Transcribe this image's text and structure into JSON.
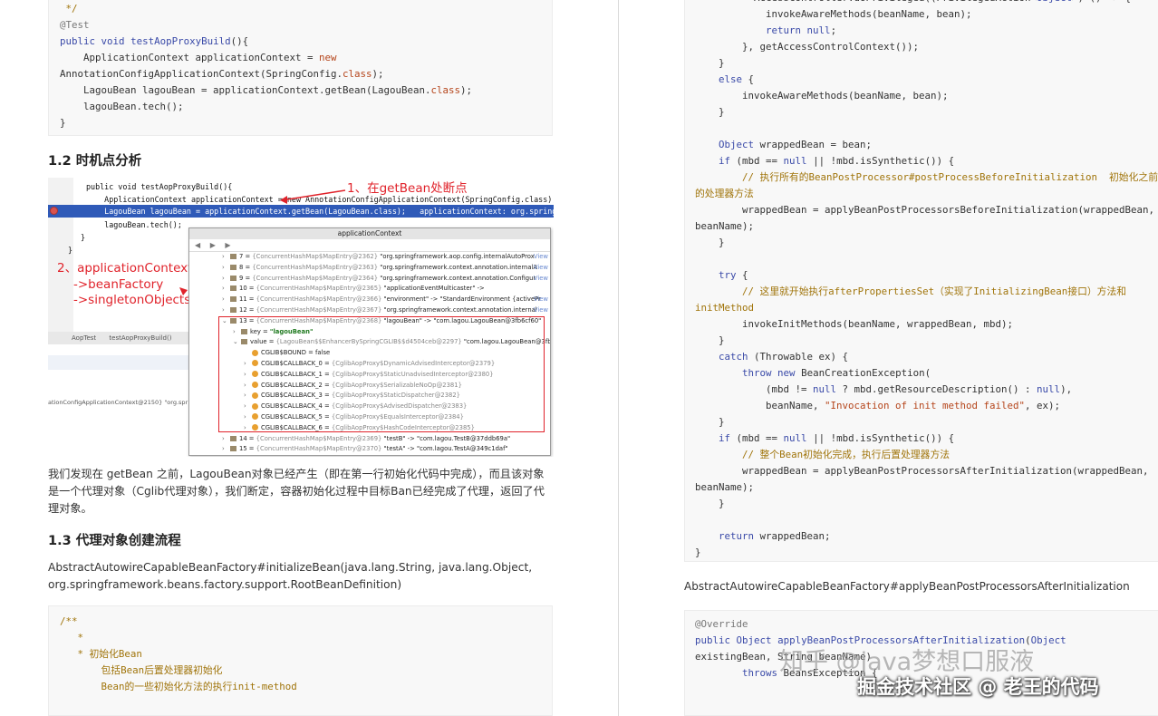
{
  "left": {
    "code1": [
      [
        [
          "cmt",
          " */"
        ]
      ],
      [
        [
          "ann",
          "@Test"
        ]
      ],
      [
        [
          "kw",
          "public"
        ],
        [
          "",
          " "
        ],
        [
          "kw",
          "void"
        ],
        [
          "",
          " "
        ],
        [
          "kw",
          "testAopProxyBuild"
        ],
        [
          "",
          "(){"
        ]
      ],
      [
        [
          "",
          "    ApplicationContext applicationContext = "
        ],
        [
          "str",
          "new"
        ]
      ],
      [
        [
          "",
          "AnnotationConfigApplicationContext(SpringConfig."
        ],
        [
          "str",
          "class"
        ],
        [
          "",
          ");"
        ]
      ],
      [
        [
          "",
          "    LagouBean lagouBean = applicationContext.getBean(LagouBean."
        ],
        [
          "str",
          "class"
        ],
        [
          "",
          ");"
        ]
      ],
      [
        [
          "",
          "    lagouBean.tech();"
        ]
      ],
      [
        [
          "",
          "}"
        ]
      ]
    ],
    "heading_1_2": "1.2 时机点分析",
    "ide": {
      "lines": [
        "public void testAopProxyBuild(){",
        "    ApplicationContext applicationContext = new AnnotationConfigApplicationContext(SpringConfig.class);  applica",
        "    LagouBean lagouBean = applicationContext.getBean(LagouBean.class);   applicationContext: org.springframework",
        "    lagouBean.tech();",
        "}",
        "}"
      ],
      "annotation1": "1、在getBean处断点",
      "annotation2": [
        "2、applicationContext",
        "->beanFactory",
        "->singletonObjects"
      ],
      "tab_left": "AopTest",
      "tab_right": "testAopProxyBuild()",
      "status": "ationConfigApplicationContext@2150} \"org.spr",
      "popup_title": "applicationContext",
      "popup_tools": "◀ ▶ ▶",
      "popup_rows": [
        {
          "ind": 0,
          "ar": "›",
          "ic": "ic",
          "main": "7 = ",
          "gray": "{ConcurrentHashMap$MapEntry@2362} ",
          "rest": "\"org.springframework.aop.config.internalAutoProx",
          "green": "",
          "view": "View"
        },
        {
          "ind": 0,
          "ar": "›",
          "ic": "ic",
          "main": "8 = ",
          "gray": "{ConcurrentHashMap$MapEntry@2363} ",
          "rest": "\"org.springframework.context.annotation.internalA",
          "green": "",
          "view": "View"
        },
        {
          "ind": 0,
          "ar": "›",
          "ic": "ic",
          "main": "9 = ",
          "gray": "{ConcurrentHashMap$MapEntry@2364} ",
          "rest": "\"org.springframework.context.annotation.Configur",
          "green": "",
          "view": "View"
        },
        {
          "ind": 0,
          "ar": "›",
          "ic": "ic",
          "main": "10 = ",
          "gray": "{ConcurrentHashMap$MapEntry@2365} ",
          "rest": "\"applicationEventMulticaster\" ->",
          "green": "",
          "view": ""
        },
        {
          "ind": 0,
          "ar": "›",
          "ic": "ic",
          "main": "11 = ",
          "gray": "{ConcurrentHashMap$MapEntry@2366} ",
          "rest": "\"environment\" -> \"StandardEnvironment {activePr",
          "green": "",
          "view": "View"
        },
        {
          "ind": 0,
          "ar": "›",
          "ic": "ic",
          "main": "12 = ",
          "gray": "{ConcurrentHashMap$MapEntry@2367} ",
          "rest": "\"org.springframework.context.annotation.internal",
          "green": "",
          "view": "View"
        },
        {
          "ind": 0,
          "ar": "⌄",
          "ic": "ic",
          "main": "13 = ",
          "gray": "{ConcurrentHashMap$MapEntry@2368} ",
          "rest": "\"lagouBean\" -> \"com.lagou.LagouBean@3fb6cf60\"",
          "green": "",
          "view": ""
        },
        {
          "ind": 1,
          "ar": "›",
          "ic": "ic",
          "main": "key = ",
          "gray": "",
          "rest": "",
          "green": "\"lagouBean\"",
          "view": ""
        },
        {
          "ind": 1,
          "ar": "⌄",
          "ic": "ic",
          "main": "value = ",
          "gray": "{LagouBean$$EnhancerBySpringCGLIB$$d4504ceb@2297} ",
          "rest": "\"com.lagou.LagouBean@3fb6cf6",
          "green": "",
          "view": ""
        },
        {
          "ind": 2,
          "ar": "",
          "ic": "fic",
          "main": "CGLIB$BOUND = false",
          "gray": "",
          "rest": "",
          "green": "",
          "view": ""
        },
        {
          "ind": 2,
          "ar": "›",
          "ic": "fic",
          "main": "CGLIB$CALLBACK_0 = ",
          "gray": "{CglibAopProxy$DynamicAdvisedInterceptor@2379}",
          "rest": "",
          "green": "",
          "view": ""
        },
        {
          "ind": 2,
          "ar": "›",
          "ic": "fic",
          "main": "CGLIB$CALLBACK_1 = ",
          "gray": "{CglibAopProxy$StaticUnadvisedInterceptor@2380}",
          "rest": "",
          "green": "",
          "view": ""
        },
        {
          "ind": 2,
          "ar": "›",
          "ic": "fic",
          "main": "CGLIB$CALLBACK_2 = ",
          "gray": "{CglibAopProxy$SerializableNoOp@2381}",
          "rest": "",
          "green": "",
          "view": ""
        },
        {
          "ind": 2,
          "ar": "›",
          "ic": "fic",
          "main": "CGLIB$CALLBACK_3 = ",
          "gray": "{CglibAopProxy$StaticDispatcher@2382}",
          "rest": "",
          "green": "",
          "view": ""
        },
        {
          "ind": 2,
          "ar": "›",
          "ic": "fic",
          "main": "CGLIB$CALLBACK_4 = ",
          "gray": "{CglibAopProxy$AdvisedDispatcher@2383}",
          "rest": "",
          "green": "",
          "view": ""
        },
        {
          "ind": 2,
          "ar": "›",
          "ic": "fic",
          "main": "CGLIB$CALLBACK_5 = ",
          "gray": "{CglibAopProxy$EqualsInterceptor@2384}",
          "rest": "",
          "green": "",
          "view": ""
        },
        {
          "ind": 2,
          "ar": "›",
          "ic": "fic",
          "main": "CGLIB$CALLBACK_6 = ",
          "gray": "{CglibAopProxy$HashCodeInterceptor@2385}",
          "rest": "",
          "green": "",
          "view": ""
        },
        {
          "ind": 0,
          "ar": "›",
          "ic": "ic",
          "main": "14 = ",
          "gray": "{ConcurrentHashMap$MapEntry@2369} ",
          "rest": "\"testB\" -> \"com.lagou.TestB@37ddb69a\"",
          "green": "",
          "view": ""
        },
        {
          "ind": 0,
          "ar": "›",
          "ic": "ic",
          "main": "15 = ",
          "gray": "{ConcurrentHashMap$MapEntry@2370} ",
          "rest": "\"testA\" -> \"com.lagou.TestA@349c1daf\"",
          "green": "",
          "view": ""
        }
      ]
    },
    "para1": [
      "我们发现在 getBean 之前，LagouBean对象已经产生（即在第一行初始化代码中完成），而且该对象",
      "是一个代理对象（Cglib代理对象），我们断定，容器初始化过程中目标Ban已经完成了代理，返回了代",
      "理对象。"
    ],
    "heading_1_3": "1.3 代理对象创建流程",
    "para2": [
      "AbstractAutowireCapableBeanFactory#initializeBean(java.lang.String, java.lang.Object,",
      "org.springframework.beans.factory.support.RootBeanDefinition)"
    ],
    "code2": [
      [
        [
          "cmt",
          "/**"
        ]
      ],
      [
        [
          "cmt",
          "   *"
        ]
      ],
      [
        [
          "cmt",
          "   * 初始化Bean"
        ]
      ],
      [
        [
          "cmt",
          "       包括Bean后置处理器初始化"
        ]
      ],
      [
        [
          "cmt",
          "       Bean的一些初始化方法的执行init-method"
        ]
      ]
    ]
  },
  "right": {
    "code1": [
      [
        [
          "",
          "          AccessController.doPrivileged((PrivilegedAction<"
        ],
        [
          "kw",
          "Object"
        ],
        [
          "",
          ">) () -> {"
        ]
      ],
      [
        [
          "",
          "            invokeAwareMethods(beanName, bean);"
        ]
      ],
      [
        [
          "",
          "            "
        ],
        [
          "kw",
          "return"
        ],
        [
          "",
          " "
        ],
        [
          "kw",
          "null"
        ],
        [
          "",
          ";"
        ]
      ],
      [
        [
          "",
          "        }, getAccessControlContext());"
        ]
      ],
      [
        [
          "",
          "    }"
        ]
      ],
      [
        [
          "",
          "    "
        ],
        [
          "kw",
          "else"
        ],
        [
          "",
          " {"
        ]
      ],
      [
        [
          "",
          "        invokeAwareMethods(beanName, bean);"
        ]
      ],
      [
        [
          "",
          "    }"
        ]
      ],
      [
        [
          "",
          ""
        ]
      ],
      [
        [
          "",
          "    "
        ],
        [
          "kw",
          "Object"
        ],
        [
          "",
          " wrappedBean = bean;"
        ]
      ],
      [
        [
          "",
          "    "
        ],
        [
          "kw",
          "if"
        ],
        [
          "",
          " (mbd == "
        ],
        [
          "kw",
          "null"
        ],
        [
          "",
          " || !mbd.isSynthetic()) {"
        ]
      ],
      [
        [
          "",
          "        "
        ],
        [
          "cmt",
          "// 执行所有的BeanPostProcessor#postProcessBeforeInitialization  初始化之前"
        ]
      ],
      [
        [
          "cmt",
          "的处理器方法"
        ]
      ],
      [
        [
          "",
          "        wrappedBean = applyBeanPostProcessorsBeforeInitialization(wrappedBean,"
        ]
      ],
      [
        [
          "",
          "beanName);"
        ]
      ],
      [
        [
          "",
          "    }"
        ]
      ],
      [
        [
          "",
          ""
        ]
      ],
      [
        [
          "",
          "    "
        ],
        [
          "kw",
          "try"
        ],
        [
          "",
          " {"
        ]
      ],
      [
        [
          "",
          "        "
        ],
        [
          "cmt",
          "// 这里就开始执行afterPropertiesSet（实现了InitializingBean接口）方法和"
        ]
      ],
      [
        [
          "cmt",
          "initMethod"
        ]
      ],
      [
        [
          "",
          "        invokeInitMethods(beanName, wrappedBean, mbd);"
        ]
      ],
      [
        [
          "",
          "    }"
        ]
      ],
      [
        [
          "",
          "    "
        ],
        [
          "kw",
          "catch"
        ],
        [
          "",
          " (Throwable ex) {"
        ]
      ],
      [
        [
          "",
          "        "
        ],
        [
          "kw",
          "throw"
        ],
        [
          "",
          " "
        ],
        [
          "kw",
          "new"
        ],
        [
          "",
          " BeanCreationException("
        ]
      ],
      [
        [
          "",
          "            (mbd != "
        ],
        [
          "kw",
          "null"
        ],
        [
          "",
          " ? mbd.getResourceDescription() : "
        ],
        [
          "kw",
          "null"
        ],
        [
          "",
          "),"
        ]
      ],
      [
        [
          "",
          "            beanName, "
        ],
        [
          "str",
          "\"Invocation of init method failed\""
        ],
        [
          "",
          ", ex);"
        ]
      ],
      [
        [
          "",
          "    }"
        ]
      ],
      [
        [
          "",
          "    "
        ],
        [
          "kw",
          "if"
        ],
        [
          "",
          " (mbd == "
        ],
        [
          "kw",
          "null"
        ],
        [
          "",
          " || !mbd.isSynthetic()) {"
        ]
      ],
      [
        [
          "",
          "        "
        ],
        [
          "cmt",
          "// 整个Bean初始化完成，执行后置处理器方法"
        ]
      ],
      [
        [
          "",
          "        wrappedBean = applyBeanPostProcessorsAfterInitialization(wrappedBean,"
        ]
      ],
      [
        [
          "",
          "beanName);"
        ]
      ],
      [
        [
          "",
          "    }"
        ]
      ],
      [
        [
          "",
          ""
        ]
      ],
      [
        [
          "",
          "    "
        ],
        [
          "kw",
          "return"
        ],
        [
          "",
          " wrappedBean;"
        ]
      ],
      [
        [
          "",
          "}"
        ]
      ]
    ],
    "para1": "AbstractAutowireCapableBeanFactory#applyBeanPostProcessorsAfterInitialization",
    "code2": [
      [
        [
          "ann",
          "@Override"
        ]
      ],
      [
        [
          "kw",
          "public"
        ],
        [
          "",
          " "
        ],
        [
          "kw",
          "Object"
        ],
        [
          "",
          " "
        ],
        [
          "kw",
          "applyBeanPostProcessorsAfterInitialization"
        ],
        [
          "",
          "("
        ],
        [
          "kw",
          "Object"
        ]
      ],
      [
        [
          "",
          "existingBean, String beanName)"
        ]
      ],
      [
        [
          "",
          "        "
        ],
        [
          "kw",
          "throws"
        ],
        [
          "",
          " BeansException {"
        ]
      ]
    ]
  },
  "watermark": {
    "line1": "知乎 @java梦想口服液",
    "line2": "掘金技术社区 @ 老王的代码"
  }
}
